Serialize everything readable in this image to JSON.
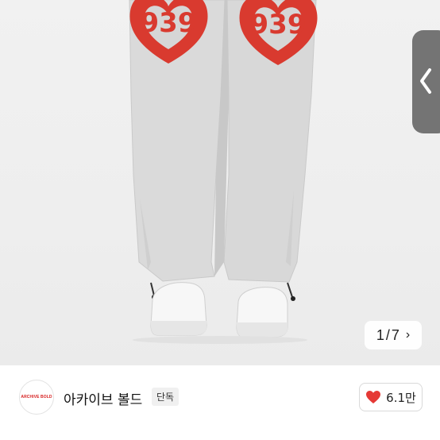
{
  "gallery": {
    "counter_current": "1",
    "counter_separator": "/",
    "counter_total": "7",
    "counter_next_icon": "chevron-right-icon",
    "side_arrow_icon": "chevron-left-icon"
  },
  "product_print": {
    "logo_text": "939"
  },
  "shop": {
    "logo_text": "ARCHIVE BOLD",
    "name": "아카이브 볼드",
    "badge": "단독",
    "like_icon": "heart-icon",
    "like_count": "6.1만"
  },
  "colors": {
    "heart": "#e53935",
    "print_red": "#d93a2f",
    "sweatpants": "#d9d9d9"
  }
}
